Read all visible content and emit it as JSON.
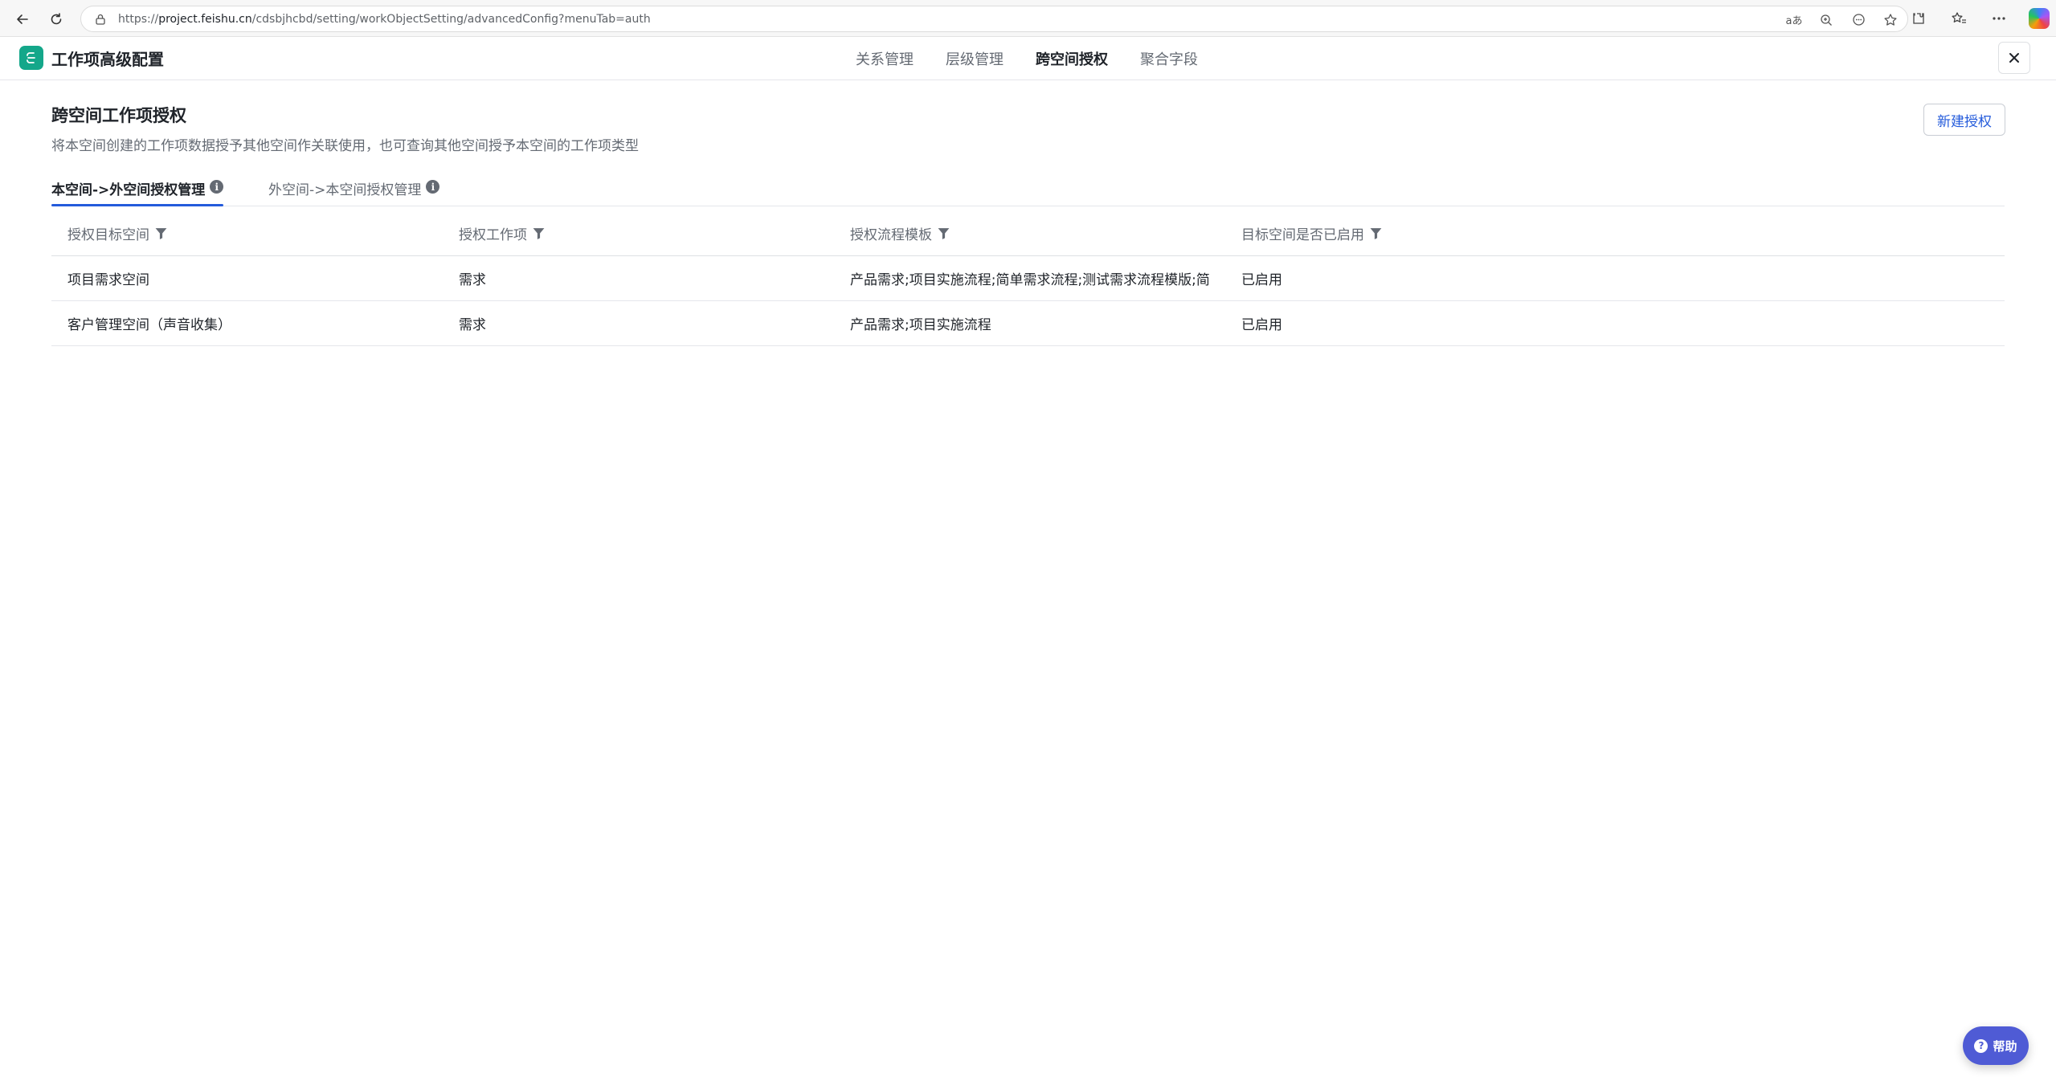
{
  "browser": {
    "url_prefix": "https://",
    "url_host": "project.feishu.cn",
    "url_path": "/cdsbjhcbd/setting/workObjectSetting/advancedConfig?menuTab=auth",
    "read_aloud_icon_text": "aあ"
  },
  "app": {
    "title": "工作项高级配置",
    "tabs": [
      {
        "label": "关系管理",
        "active": false
      },
      {
        "label": "层级管理",
        "active": false
      },
      {
        "label": "跨空间授权",
        "active": true
      },
      {
        "label": "聚合字段",
        "active": false
      }
    ]
  },
  "section": {
    "title": "跨空间工作项授权",
    "description": "将本空间创建的工作项数据授予其他空间作关联使用，也可查询其他空间授予本空间的工作项类型",
    "new_button": "新建授权"
  },
  "sub_tabs": [
    {
      "label": "本空间->外空间授权管理",
      "active": true
    },
    {
      "label": "外空间->本空间授权管理",
      "active": false
    }
  ],
  "table": {
    "columns": [
      "授权目标空间",
      "授权工作项",
      "授权流程模板",
      "目标空间是否已启用"
    ],
    "rows": [
      [
        "项目需求空间",
        "需求",
        "产品需求;项目实施流程;简单需求流程;测试需求流程模版;简",
        "已启用"
      ],
      [
        "客户管理空间（声音收集）",
        "需求",
        "产品需求;项目实施流程",
        "已启用"
      ]
    ]
  },
  "help": {
    "label": "帮助"
  },
  "colors": {
    "brand": "#14a78a",
    "accent": "#245bdb",
    "help": "#4f5bd5"
  }
}
